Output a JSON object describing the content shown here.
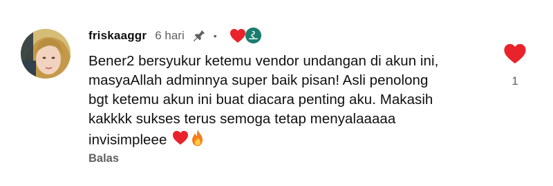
{
  "comment": {
    "username": "friskaaggr",
    "timestamp": "6 hari",
    "separator": "•",
    "creator_badge_text": "invisimple",
    "body_lines": [
      "Bener2 bersyukur ketemu vendor undangan di akun ini,",
      "masyaAllah adminnya super baik pisan! Asli penolong",
      "bgt ketemu akun ini buat diacara penting aku. Makasih",
      "kakkkk sukses terus semoga tetap menyalaaaaa",
      "invisimpleee"
    ],
    "emojis": [
      "red-heart",
      "fire"
    ],
    "reply_label": "Balas",
    "like_count": "1"
  },
  "colors": {
    "heart_red": "#e8232b",
    "muted_text": "#606060",
    "primary_text": "#0f0f0f",
    "badge_teal": "#1a7d6e"
  },
  "icons": {
    "pin": "pin-icon",
    "creator_heart": "heart-icon",
    "like": "heart-icon",
    "fire": "fire-emoji"
  }
}
